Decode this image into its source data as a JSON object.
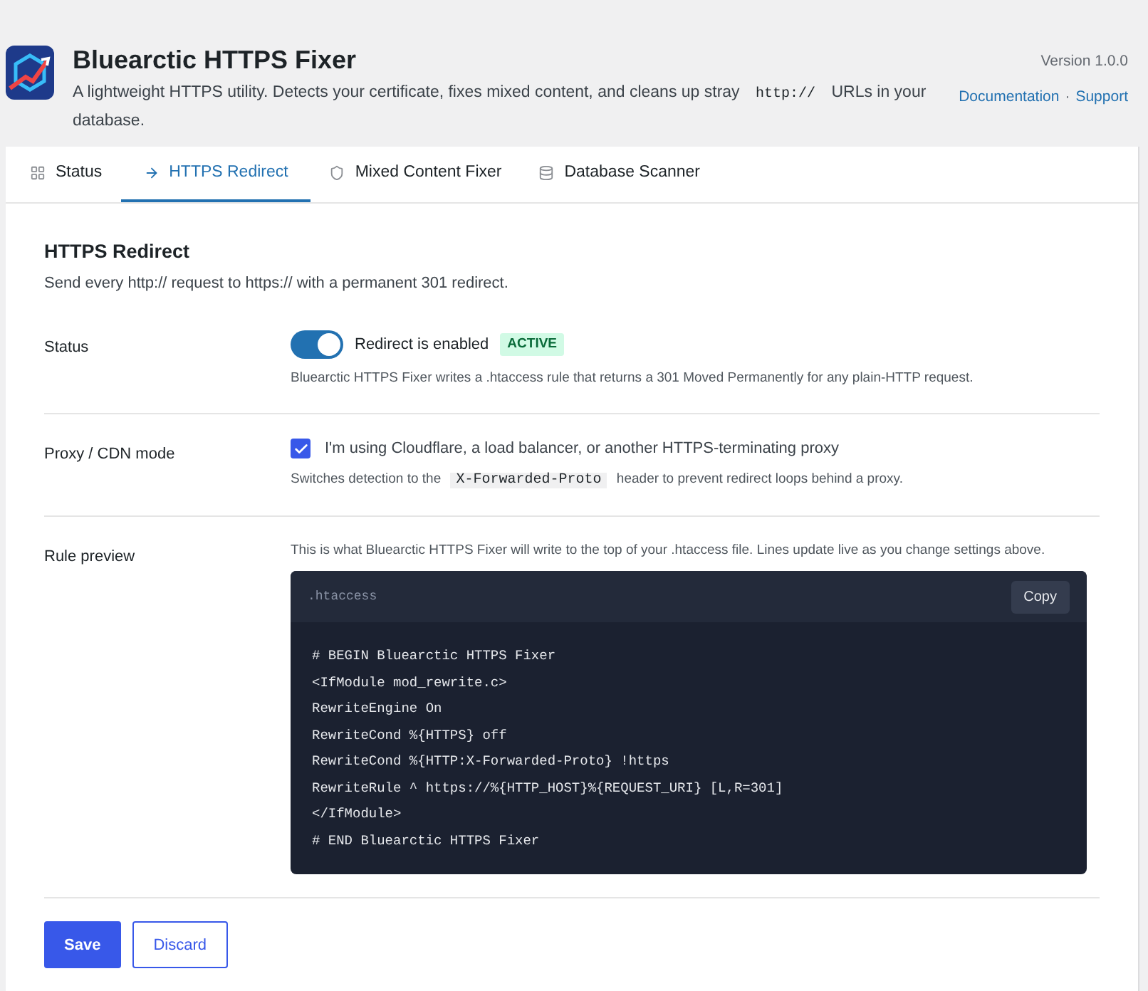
{
  "header": {
    "title": "Bluearctic HTTPS Fixer",
    "description": [
      {
        "kind": "text",
        "text": "A lightweight HTTPS utility. Detects your certificate, fixes mixed content, and cleans up stray "
      },
      {
        "kind": "code",
        "text": "http://"
      },
      {
        "kind": "text",
        "text": " URLs in your database."
      }
    ],
    "version": "Version 1.0.0",
    "links": [
      "Documentation",
      "Support"
    ],
    "link_separator": "·"
  },
  "tabs": [
    {
      "label": "Status",
      "kind": "grid",
      "selected": false
    },
    {
      "label": "HTTPS Redirect",
      "kind": "arrow",
      "selected": true
    },
    {
      "label": "Mixed Content Fixer",
      "kind": "shield",
      "selected": false
    },
    {
      "label": "Database Scanner",
      "kind": "database",
      "selected": false
    }
  ],
  "section": {
    "title": "HTTPS Redirect",
    "subtitle": "Send every http:// request to https:// with a permanent 301 redirect."
  },
  "rows": [
    {
      "kind": "toggle",
      "label": "Status",
      "on": true,
      "control_label": "Redirect is enabled",
      "badge": "ACTIVE",
      "hint": [
        {
          "kind": "text",
          "text": "Bluearctic HTTPS Fixer writes a .htaccess rule that returns a 301 Moved Permanently for any plain-HTTP request."
        }
      ]
    },
    {
      "kind": "checkbox",
      "label": "Proxy / CDN mode",
      "checked": true,
      "control_label": "I'm using Cloudflare, a load balancer, or another HTTPS-terminating proxy",
      "hint": [
        {
          "kind": "text",
          "text": "Switches detection to the "
        },
        {
          "kind": "code",
          "text": "X-Forwarded-Proto"
        },
        {
          "kind": "text",
          "text": " header to prevent redirect loops behind a proxy."
        }
      ]
    },
    {
      "kind": "preview",
      "label": "Rule preview",
      "hint": [
        {
          "kind": "text",
          "text": "This is what Bluearctic HTTPS Fixer will write to the top of your .htaccess file. Lines update live as you change settings above."
        }
      ],
      "file_name": ".htaccess",
      "copy_button": "Copy",
      "lines": [
        "# BEGIN Bluearctic HTTPS Fixer",
        "<IfModule mod_rewrite.c>",
        "RewriteEngine On",
        "RewriteCond %{HTTPS} off",
        "RewriteCond %{HTTP:X-Forwarded-Proto} !https",
        "RewriteRule ^ https://%{HTTP_HOST}%{REQUEST_URI} [L,R=301]",
        "</IfModule>",
        "# END Bluearctic HTTPS Fixer"
      ]
    }
  ],
  "buttons": [
    {
      "label": "Save",
      "kind": "primary"
    },
    {
      "label": "Discard",
      "kind": "secondary"
    }
  ]
}
